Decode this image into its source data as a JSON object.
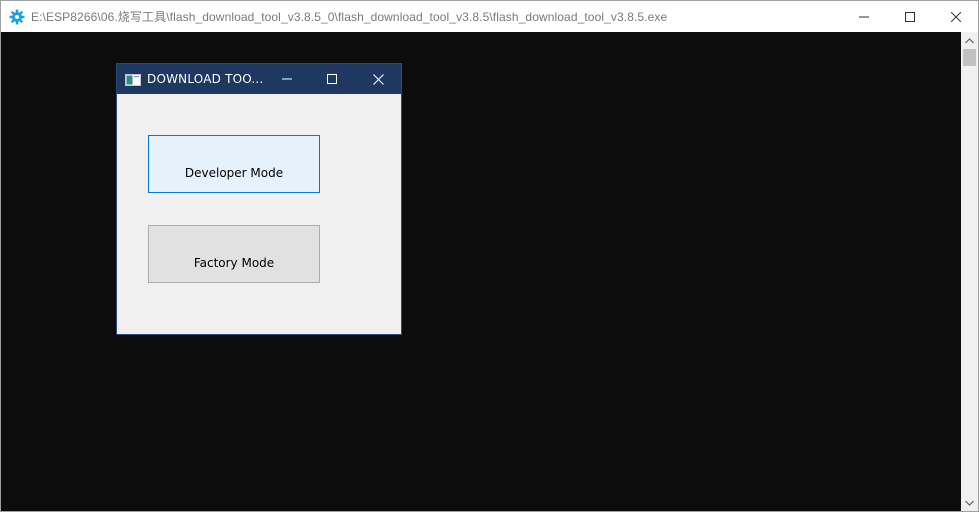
{
  "console": {
    "title": "E:\\ESP8266\\06.烧写工具\\flash_download_tool_v3.8.5_0\\flash_download_tool_v3.8.5\\flash_download_tool_v3.8.5.exe",
    "icon": "gear-icon",
    "controls": [
      "minimize-icon",
      "maximize-icon",
      "close-icon"
    ]
  },
  "dialog": {
    "title": "DOWNLOAD TOO...",
    "icon": "window-icon",
    "buttons": {
      "developer": "Developer Mode",
      "factory": "Factory Mode"
    }
  },
  "colors": {
    "console_bg": "#0c0c0c",
    "dialog_titlebar": "#1f3861",
    "accent": "#0078d7",
    "gear_icon": "#1ba1e2"
  }
}
